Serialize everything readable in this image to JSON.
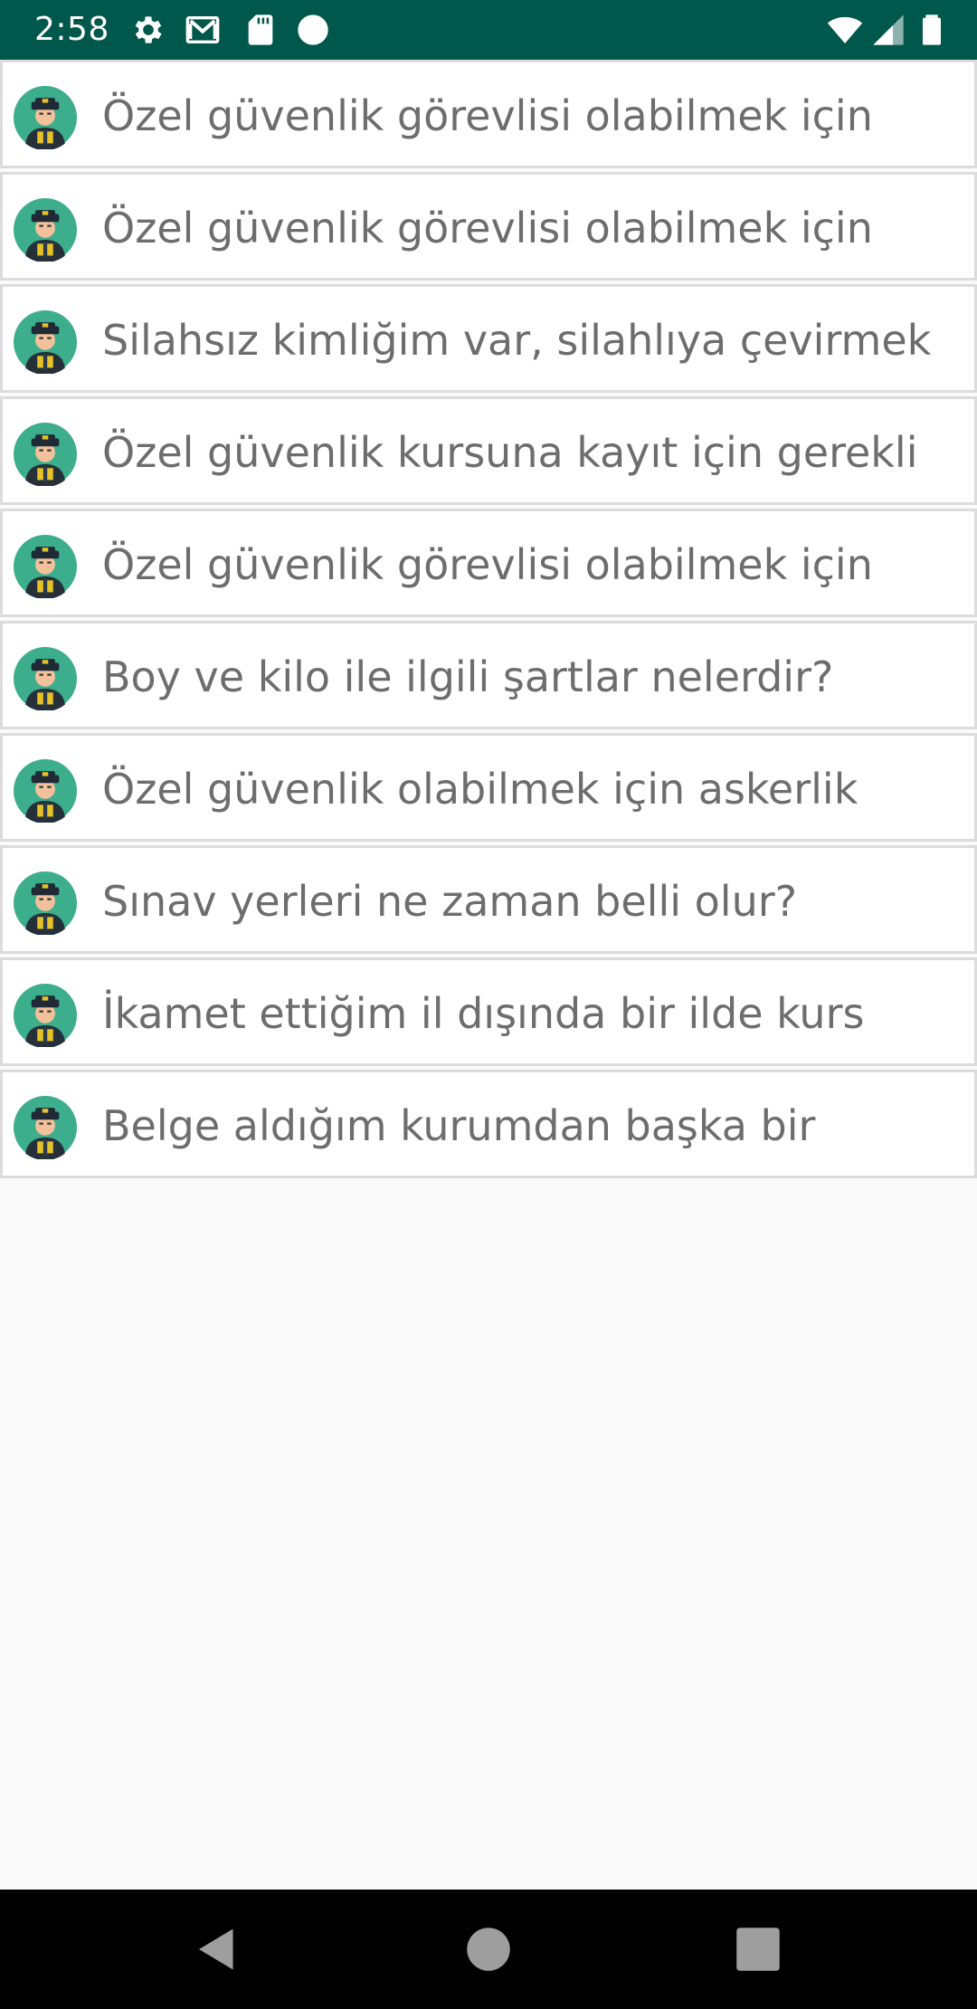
{
  "status_bar": {
    "time": "2:58",
    "background_color": "#00574b",
    "left_icons": [
      "settings-gear-icon",
      "gmail-icon",
      "sd-card-icon",
      "circle-notification-icon"
    ],
    "right_icons": [
      "wifi-icon",
      "cell-signal-icon",
      "battery-icon"
    ]
  },
  "list": {
    "items": [
      {
        "label": "Özel güvenlik görevlisi olabilmek için",
        "icon": "security-guard-avatar-icon"
      },
      {
        "label": "Özel güvenlik görevlisi olabilmek için",
        "icon": "security-guard-avatar-icon"
      },
      {
        "label": "Silahsız kimliğim var, silahlıya çevirmek",
        "icon": "security-guard-avatar-icon"
      },
      {
        "label": "Özel güvenlik kursuna kayıt için gerekli",
        "icon": "security-guard-avatar-icon"
      },
      {
        "label": "Özel güvenlik görevlisi olabilmek için",
        "icon": "security-guard-avatar-icon"
      },
      {
        "label": "Boy ve kilo ile ilgili şartlar nelerdir?",
        "icon": "security-guard-avatar-icon"
      },
      {
        "label": "Özel güvenlik olabilmek için askerlik",
        "icon": "security-guard-avatar-icon"
      },
      {
        "label": "Sınav yerleri ne zaman belli olur?",
        "icon": "security-guard-avatar-icon"
      },
      {
        "label": "İkamet ettiğim il dışında bir ilde kurs",
        "icon": "security-guard-avatar-icon"
      },
      {
        "label": "Belge aldığım kurumdan başka bir",
        "icon": "security-guard-avatar-icon"
      }
    ]
  },
  "nav_bar": {
    "buttons": [
      "back-icon",
      "home-icon",
      "recents-icon"
    ]
  }
}
